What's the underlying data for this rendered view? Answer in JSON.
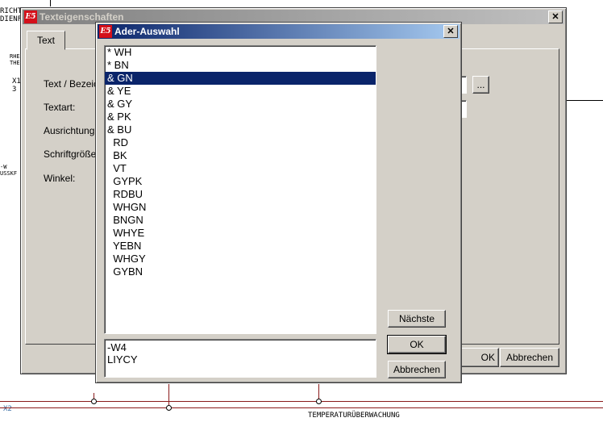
{
  "background": {
    "top_left_text": "RICHT\nDIENF",
    "left_small_1": "RHE\nTHE",
    "left_small_2": "X1\n3",
    "left_side": "-W\nUSSKF",
    "bottom_left": "X2",
    "bottom_center": "TEMPERATURÜBERWACHUNG"
  },
  "back_window": {
    "title": "Texteigenschaften",
    "tab": "Text",
    "labels": {
      "text": "Text / Bezeic",
      "textart": "Textart:",
      "ausrichtung": "Ausrichtung:",
      "schriftgroesse": "Schriftgröße:",
      "winkel": "Winkel:"
    },
    "ellipsis": "...",
    "ok": "OK",
    "cancel": "Abbrechen"
  },
  "dialog": {
    "title": "Ader-Auswahl",
    "items": [
      "* WH",
      "* BN",
      "& GN",
      "& YE",
      "& GY",
      "& PK",
      "& BU",
      "  RD",
      "  BK",
      "  VT",
      "  GYPK",
      "  RDBU",
      "  WHGN",
      "  BNGN",
      "  WHYE",
      "  YEBN",
      "  WHGY",
      "  GYBN"
    ],
    "selected_index": 2,
    "info": [
      "-W4",
      "LIYCY"
    ],
    "buttons": {
      "next": "Nächste",
      "ok": "OK",
      "cancel": "Abbrechen"
    }
  },
  "colors": {
    "title_active": "#0a246a",
    "selection": "#0a246a",
    "dialog_bg": "#d4d0c8"
  }
}
